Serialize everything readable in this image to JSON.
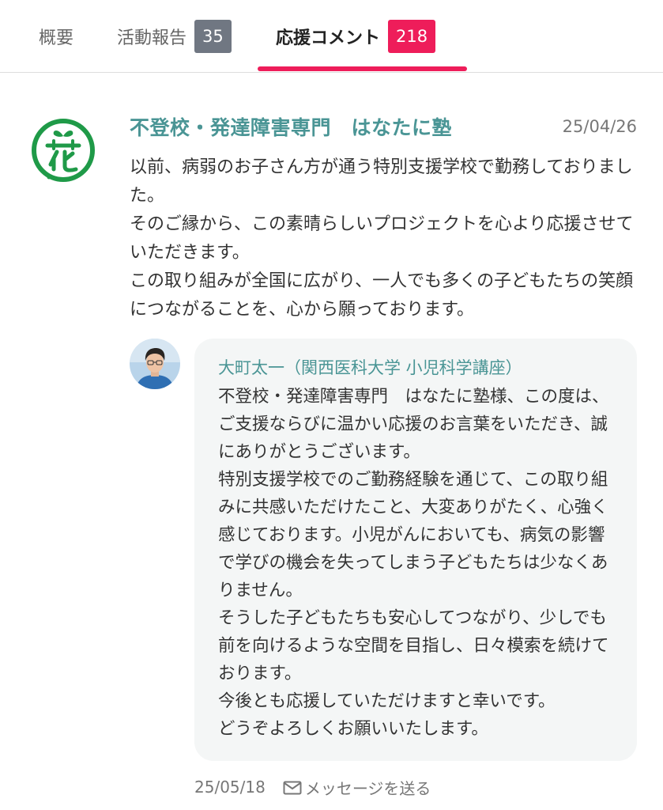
{
  "tabs": {
    "overview": {
      "label": "概要"
    },
    "reports": {
      "label": "活動報告",
      "count": "35"
    },
    "comments": {
      "label": "応援コメント",
      "count": "218",
      "active": true
    }
  },
  "colors": {
    "accent": "#ee1d5a",
    "teal": "#4a9595",
    "badge_gray": "#707782",
    "logo_green": "#1f9a48",
    "bubble_bg": "#f4f6f6"
  },
  "comment": {
    "author": "不登校・発達障害専門　はなたに塾",
    "logo_icon": "hana-flower-logo",
    "date": "25/04/26",
    "paragraphs": [
      "以前、病弱のお子さん方が通う特別支援学校で勤務しておりました。",
      "そのご縁から、この素晴らしいプロジェクトを心より応援させていただきます。",
      "この取り組みが全国に広がり、一人でも多くの子どもたちの笑顔につながることを、心から願っております。"
    ]
  },
  "reply": {
    "avatar_icon": "person-avatar",
    "author": "大町太一（関西医科大学 小児科学講座）",
    "paragraphs": [
      "不登校・発達障害専門　はなたに塾様、この度は、ご支援ならびに温かい応援のお言葉をいただき、誠にありがとうございます。",
      "特別支援学校でのご勤務経験を通じて、この取り組みに共感いただけたこと、大変ありがたく、心強く感じております。小児がんにおいても、病気の影響で学びの機会を失ってしまう子どもたちは少なくありません。",
      "そうした子どもたちも安心してつながり、少しでも前を向けるような空間を目指し、日々模索を続けております。",
      "今後とも応援していただけますと幸いです。",
      "どうぞよろしくお願いいたします。"
    ],
    "date": "25/05/18",
    "send_message_label": "メッセージを送る",
    "send_message_icon": "mail-icon"
  }
}
